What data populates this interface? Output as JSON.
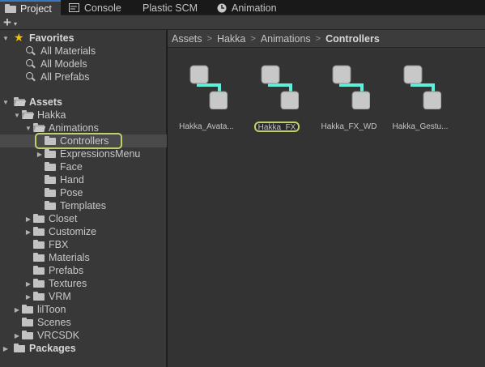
{
  "tabs": [
    {
      "label": "Project",
      "icon": "folder-icon",
      "active": true
    },
    {
      "label": "Console",
      "icon": "console-icon",
      "active": false
    },
    {
      "label": "Plastic SCM",
      "icon": "",
      "active": false
    },
    {
      "label": "Animation",
      "icon": "clock-icon",
      "active": false
    }
  ],
  "toolbar": {
    "add_label": "+",
    "add_caret": "▾"
  },
  "tree": {
    "favorites": {
      "label": "Favorites",
      "items": [
        "All Materials",
        "All Models",
        "All Prefabs"
      ]
    },
    "assets": {
      "label": "Assets",
      "hakka": "Hakka",
      "animations": "Animations",
      "controllers": "Controllers",
      "expressions_menu": "ExpressionsMenu",
      "face": "Face",
      "hand": "Hand",
      "pose": "Pose",
      "templates": "Templates",
      "closet": "Closet",
      "customize": "Customize",
      "fbx": "FBX",
      "materials": "Materials",
      "prefabs": "Prefabs",
      "textures": "Textures",
      "vrm": "VRM",
      "liltoon": "lilToon",
      "scenes": "Scenes",
      "vrcsdk": "VRCSDK"
    },
    "packages": "Packages"
  },
  "breadcrumb": {
    "items": [
      "Assets",
      "Hakka",
      "Animations"
    ],
    "current": "Controllers",
    "separator": ">"
  },
  "assets": [
    {
      "name": "Hakka_Avata...",
      "selected": false
    },
    {
      "name": "Hakka_FX",
      "selected": true
    },
    {
      "name": "Hakka_FX_WD",
      "selected": false
    },
    {
      "name": "Hakka_Gestu...",
      "selected": false
    }
  ],
  "colors": {
    "accent": "#3a79bb",
    "selection_ring": "#c5cf6a",
    "controller_link": "#5ef0d8",
    "star": "#f2c300"
  }
}
